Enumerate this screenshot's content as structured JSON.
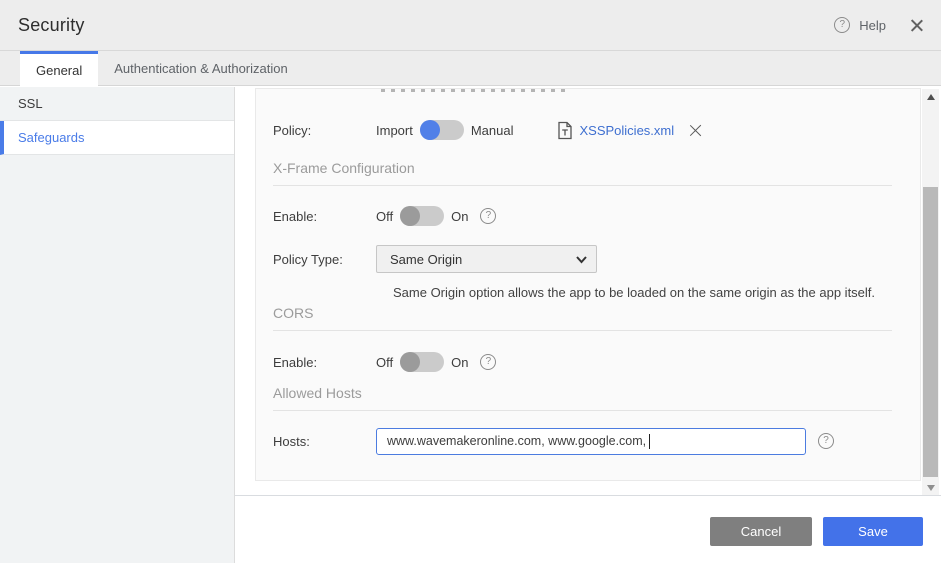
{
  "colors": {
    "accent": "#4678e8",
    "link": "#3e6fd0",
    "toggle_on": "#5180e8",
    "toggle_knob_off": "#9b9b9b",
    "save_button": "#4372e9",
    "cancel_button": "#7f7f7f",
    "sidebar_active": "#4a7ce8"
  },
  "header": {
    "title": "Security",
    "help_label": "Help"
  },
  "tabs": [
    {
      "label": "General",
      "active": true
    },
    {
      "label": "Authentication & Authorization",
      "active": false
    }
  ],
  "sidebar": {
    "items": [
      {
        "label": "SSL",
        "active": false
      },
      {
        "label": "Safeguards",
        "active": true
      }
    ]
  },
  "panel": {
    "policy": {
      "label": "Policy:",
      "option_left": "Import",
      "option_right": "Manual",
      "selected": "Import",
      "file_name": "XSSPolicies.xml"
    },
    "xframe": {
      "title": "X-Frame Configuration",
      "enable_label": "Enable:",
      "off_label": "Off",
      "on_label": "On",
      "enable_state": "Off",
      "policy_type_label": "Policy Type:",
      "policy_type_value": "Same Origin",
      "helper_text": "Same Origin option allows the app to be loaded on the same origin as the app itself."
    },
    "cors": {
      "title": "CORS",
      "enable_label": "Enable:",
      "off_label": "Off",
      "on_label": "On",
      "enable_state": "Off"
    },
    "allowed_hosts": {
      "title": "Allowed Hosts",
      "hosts_label": "Hosts:",
      "hosts_value": "www.wavemakeronline.com, www.google.com,"
    }
  },
  "footer": {
    "cancel_label": "Cancel",
    "save_label": "Save"
  }
}
